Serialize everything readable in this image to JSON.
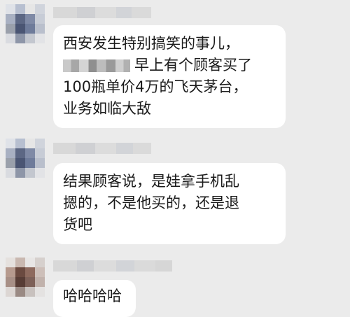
{
  "messages": [
    {
      "lines": [
        "西安发生特别搞笑的事儿，",
        "早上有个顾客买了",
        "100瓶单价4万的飞天茅台，",
        "业务如临大敌"
      ]
    },
    {
      "lines": [
        "结果顾客说，是娃拿手机乱",
        "摁的，不是他买的，还是退",
        "货吧"
      ]
    },
    {
      "lines": [
        "哈哈哈哈"
      ]
    }
  ]
}
